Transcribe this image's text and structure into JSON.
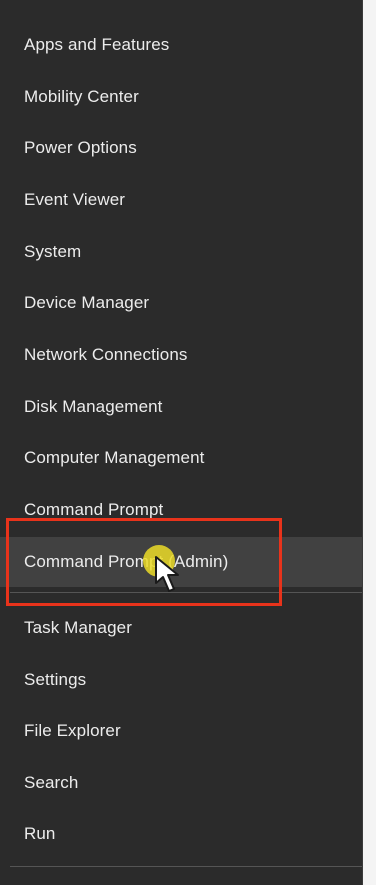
{
  "menu": {
    "items": [
      {
        "label": "Apps and Features"
      },
      {
        "label": "Mobility Center"
      },
      {
        "label": "Power Options"
      },
      {
        "label": "Event Viewer"
      },
      {
        "label": "System"
      },
      {
        "label": "Device Manager"
      },
      {
        "label": "Network Connections"
      },
      {
        "label": "Disk Management"
      },
      {
        "label": "Computer Management"
      },
      {
        "label": "Command Prompt"
      },
      {
        "label": "Command Prompt (Admin)"
      },
      {
        "label": "Task Manager"
      },
      {
        "label": "Settings"
      },
      {
        "label": "File Explorer"
      },
      {
        "label": "Search"
      },
      {
        "label": "Run"
      }
    ],
    "hovered_item": "Command Prompt (Admin)"
  },
  "colors": {
    "menu_background": "#2b2b2b",
    "hover_background": "#414141",
    "text": "#ececec",
    "annotation_border": "#e8331b",
    "cursor_halo": "#ecdc28"
  },
  "icons": {
    "cursor": "mouse-pointer-icon"
  }
}
